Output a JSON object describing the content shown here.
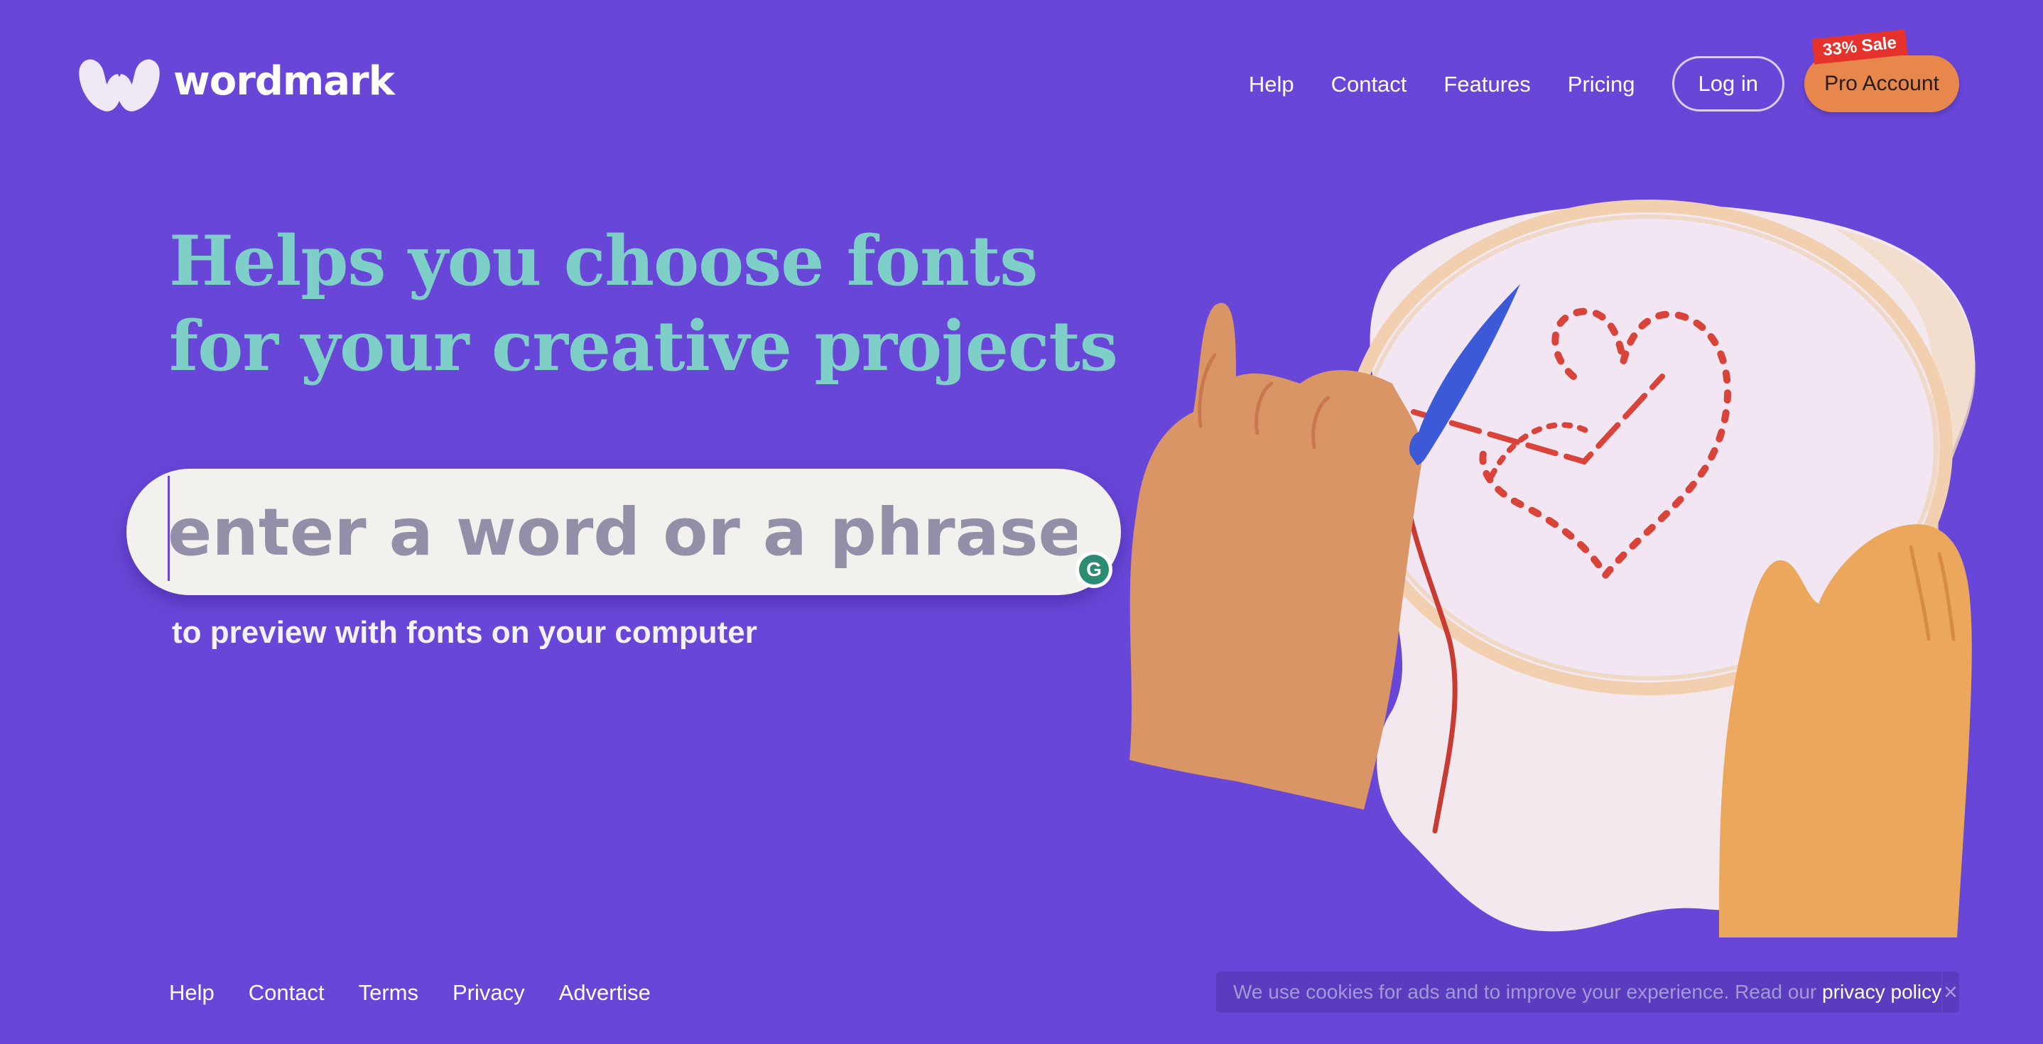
{
  "header": {
    "logo_text": "wordmark",
    "logo_icon": "w-logo-icon",
    "nav": {
      "help": "Help",
      "contact": "Contact",
      "features": "Features",
      "pricing": "Pricing"
    },
    "login_label": "Log in",
    "pro_label": "Pro Account",
    "sale_badge": "33% Sale"
  },
  "hero": {
    "headline_line1": "Helps you choose fonts",
    "headline_line2": "for your creative projects",
    "search_placeholder": "enter a word or a phrase",
    "search_value": "",
    "subtext": "to preview with fonts on your computer",
    "grammarly_icon": "grammarly-icon",
    "grammarly_letter": "G"
  },
  "illustration": {
    "subject": "hands-embroidering-heart-on-hoop"
  },
  "footer": {
    "links": {
      "help": "Help",
      "contact": "Contact",
      "terms": "Terms",
      "privacy": "Privacy",
      "advertise": "Advertise"
    }
  },
  "cookie": {
    "text": "We use cookies for ads and to improve your experience. Read our ",
    "link": "privacy policy",
    "close_icon": "close-icon",
    "close_glyph": "×"
  },
  "colors": {
    "background": "#6846D8",
    "headline": "#7FCFC9",
    "pro_button": "#E8874B",
    "sale_badge": "#E5322C",
    "search_box": "#F2F1EE"
  }
}
